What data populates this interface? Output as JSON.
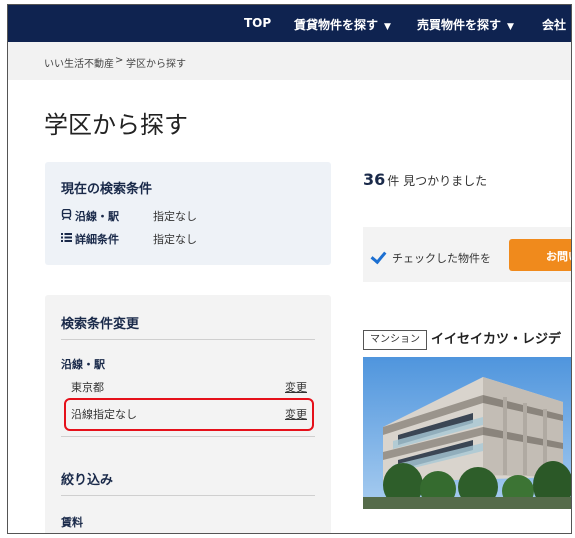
{
  "nav": {
    "top": "TOP",
    "rent": "賃貸物件を探す",
    "sale": "売買物件を探す",
    "company": "会社"
  },
  "breadcrumb": {
    "home": "いい生活不動産",
    "sep": ">",
    "current": "学区から探す"
  },
  "page_title": "学区から探す",
  "current_conditions": {
    "title": "現在の検索条件",
    "rows": [
      {
        "icon": "train-icon",
        "label": "沿線・駅",
        "value": "指定なし"
      },
      {
        "icon": "list-icon",
        "label": "詳細条件",
        "value": "指定なし"
      }
    ]
  },
  "change_conditions": {
    "title": "検索条件変更",
    "line_heading": "沿線・駅",
    "rows": [
      {
        "text": "東京都",
        "link": "変更"
      },
      {
        "text": "沿線指定なし",
        "link": "変更"
      }
    ],
    "narrow_heading": "絞り込み",
    "rent_heading": "賃料"
  },
  "results": {
    "count": "36",
    "suffix": "件 見つかりました"
  },
  "checkbar": {
    "text": "チェックした物件を",
    "button": "お問い"
  },
  "property": {
    "tag": "マンション",
    "name": "イイセイカツ・レジデ"
  },
  "colors": {
    "nav_bg": "#0f2350",
    "accent": "#f08a1c",
    "highlight": "#e5101a",
    "check": "#1c6fd1"
  }
}
